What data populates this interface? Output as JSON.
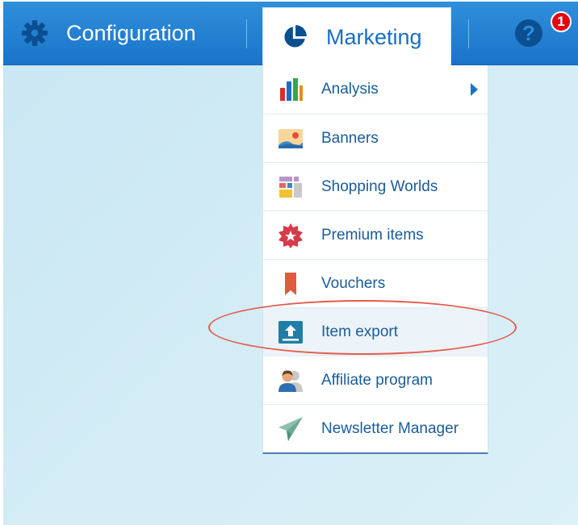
{
  "topbar": {
    "configuration_label": "Configuration",
    "marketing_label": "Marketing",
    "help_symbol": "?",
    "notification_count": "1"
  },
  "menu": {
    "items": [
      {
        "label": "Analysis",
        "icon": "bar-chart-icon",
        "has_submenu": true
      },
      {
        "label": "Banners",
        "icon": "banner-image-icon"
      },
      {
        "label": "Shopping Worlds",
        "icon": "shopping-worlds-icon"
      },
      {
        "label": "Premium items",
        "icon": "premium-star-icon"
      },
      {
        "label": "Vouchers",
        "icon": "voucher-bookmark-icon"
      },
      {
        "label": "Item export",
        "icon": "upload-export-icon",
        "highlighted": true
      },
      {
        "label": "Affiliate program",
        "icon": "affiliate-users-icon"
      },
      {
        "label": "Newsletter Manager",
        "icon": "paper-plane-icon"
      }
    ]
  },
  "colors": {
    "topbar": "#1a74c8",
    "menu_text": "#1a5c99",
    "highlight_ring": "#e55a4a",
    "badge": "#e30613"
  }
}
